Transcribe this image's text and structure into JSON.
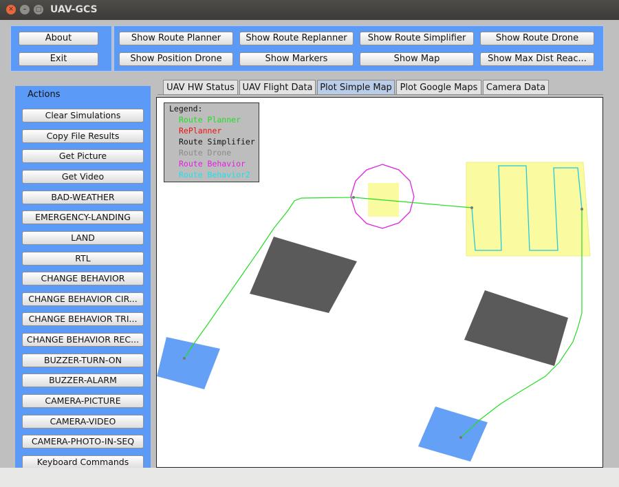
{
  "window": {
    "title": "UAV-GCS"
  },
  "toolbar": {
    "left": [
      "About",
      "Exit"
    ],
    "right": [
      "Show Route Planner",
      "Show Route Replanner",
      "Show Route Simplifier",
      "Show Route Drone",
      "Show Position Drone",
      "Show Markers",
      "Show Map",
      "Show Max Dist Reac..."
    ]
  },
  "sidebar": {
    "title": "Actions",
    "items": [
      "Clear Simulations",
      "Copy File Results",
      "Get Picture",
      "Get Video",
      "BAD-WEATHER",
      "EMERGENCY-LANDING",
      "LAND",
      "RTL",
      "CHANGE BEHAVIOR",
      "CHANGE BEHAVIOR CIR...",
      "CHANGE BEHAVIOR TRI...",
      "CHANGE BEHAVIOR REC...",
      "BUZZER-TURN-ON",
      "BUZZER-ALARM",
      "CAMERA-PICTURE",
      "CAMERA-VIDEO",
      "CAMERA-PHOTO-IN-SEQ",
      "Keyboard Commands"
    ]
  },
  "tabs": {
    "items": [
      "UAV HW Status",
      "UAV Flight Data",
      "Plot Simple Map",
      "Plot Google Maps",
      "Camera Data"
    ],
    "active": "Plot Simple Map"
  },
  "legend": {
    "title": "Legend:",
    "entries": [
      {
        "label": "Route Planner",
        "color": "#22dd22"
      },
      {
        "label": "RePlanner",
        "color": "#ee1111"
      },
      {
        "label": "Route Simplifier",
        "color": "#111111"
      },
      {
        "label": "Route Drone",
        "color": "#8a8a8a"
      },
      {
        "label": "Route Behavior",
        "color": "#e020e0"
      },
      {
        "label": "Route Behavior2",
        "color": "#20e0e8"
      }
    ]
  },
  "colors": {
    "panel_blue": "#5b9bf7",
    "obstacle": "#5a5a5a",
    "region_yellow": "#fafaa0",
    "base_blue": "#64a0f5",
    "route_green": "#22dd22",
    "behavior_magenta": "#e020e0",
    "behavior_cyan": "#20c8e0"
  }
}
